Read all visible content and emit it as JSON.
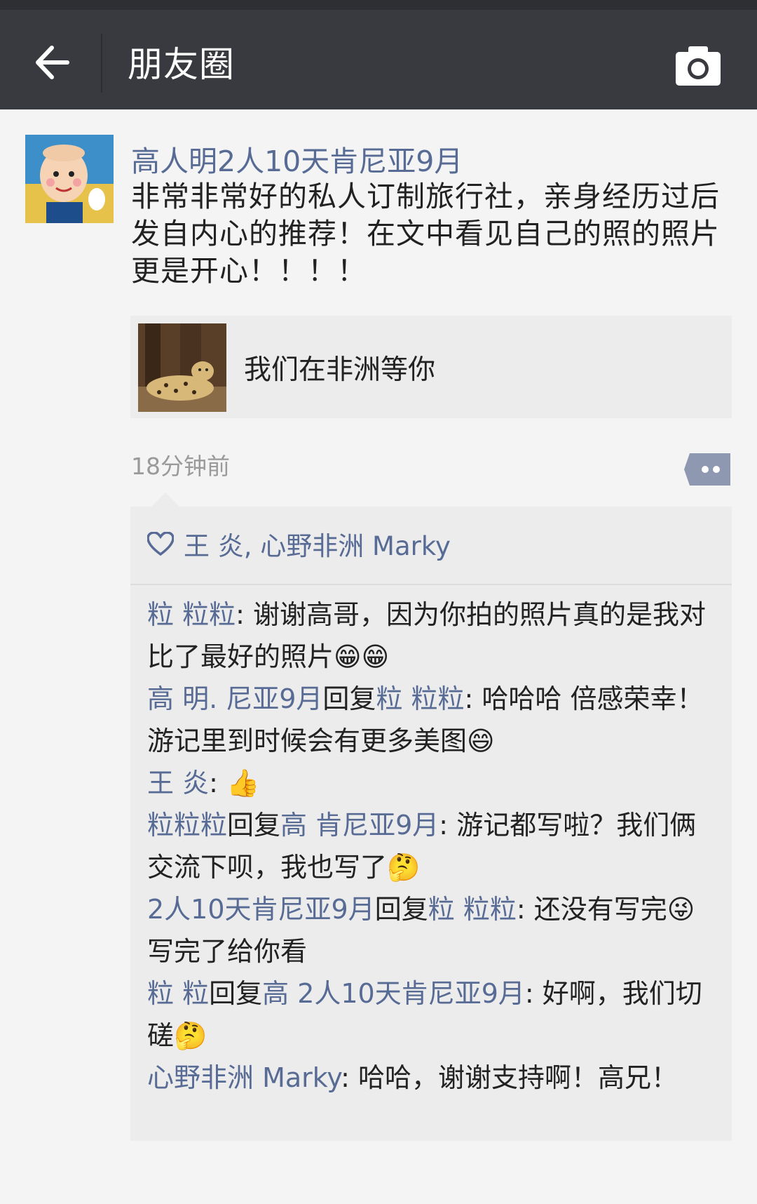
{
  "nav": {
    "title": "朋友圈",
    "back_icon": "arrow-left-icon",
    "camera_icon": "camera-icon"
  },
  "colors": {
    "navbar": "#393a3f",
    "link_blue": "#576b95",
    "background": "#f4f4f4",
    "card": "#ececec"
  },
  "post": {
    "author": "高人明2人10天肯尼亚9月",
    "text": "非常非常好的私人订制旅行社，亲身经历过后发自内心的推荐！在文中看见自己的照的照片更是开心！！！！",
    "link_card": {
      "title": "我们在非洲等你"
    },
    "timestamp": "18分钟前",
    "likes": "王   炎, 心野非洲 Marky",
    "comments": [
      {
        "name": "粒  粒粒",
        "sep": ": ",
        "text": "谢谢高哥，因为你拍的照片真的是我对比了最好的照片",
        "emoji": "😁😁"
      },
      {
        "name": "高 明.    尼亚9月",
        "reply_word": "回复",
        "reply_to": "粒  粒粒",
        "sep": ": ",
        "text": "哈哈哈 倍感荣幸！游记里到时候会有更多美图",
        "emoji": "😄"
      },
      {
        "name": "王  炎",
        "sep": ": ",
        "text": "",
        "emoji": "👍"
      },
      {
        "name": "粒粒粒",
        "reply_word": "回复",
        "reply_to": "高  肯尼亚9月",
        "sep": ": ",
        "text": "游记都写啦？我们俩交流下呗，我也写了",
        "emoji": "🤔"
      },
      {
        "name": "  2人10天肯尼亚9月",
        "reply_word": "回复",
        "reply_to": "粒  粒粒",
        "sep": ": ",
        "text": "还没有写完",
        "emoji": "😜",
        "text2": "写完了给你看"
      },
      {
        "name": "粒  粒",
        "reply_word": "回复",
        "reply_to": "高  2人10天肯尼亚9月",
        "sep": ": ",
        "text": "好啊，我们切磋",
        "emoji": "🤔"
      },
      {
        "name": "心野非洲 Marky",
        "sep": ": ",
        "text": "哈哈，谢谢支持啊！高兄！"
      }
    ]
  }
}
